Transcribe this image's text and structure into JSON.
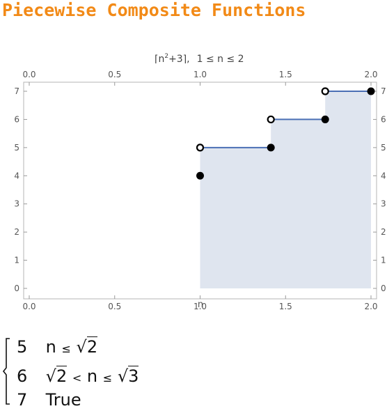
{
  "title": "Piecewise Composite Functions",
  "chart_data": {
    "type": "line",
    "title": "⌈n²+3⌉,   1 ≤ n ≤ 2",
    "title_expr_open": "⌈n",
    "title_expr_sup": "2",
    "title_expr_close": "+3⌉,",
    "title_domain": "1 ≤ n ≤ 2",
    "xlabel": "n",
    "ylabel": "",
    "xlim": [
      0,
      2
    ],
    "ylim": [
      0,
      7
    ],
    "x_ticks": [
      "0.0",
      "0.5",
      "1.0",
      "1.5",
      "2.0"
    ],
    "y_ticks": [
      "0",
      "1",
      "2",
      "3",
      "4",
      "5",
      "6",
      "7"
    ],
    "segments": [
      {
        "x": [
          1.0,
          1.41421
        ],
        "y": 5
      },
      {
        "x": [
          1.41421,
          1.73205
        ],
        "y": 6
      },
      {
        "x": [
          1.73205,
          2.0
        ],
        "y": 7
      }
    ],
    "filled_points": [
      {
        "x": 1.0,
        "y": 4
      },
      {
        "x": 1.41421,
        "y": 5
      },
      {
        "x": 1.73205,
        "y": 6
      },
      {
        "x": 2.0,
        "y": 7
      }
    ],
    "open_points": [
      {
        "x": 1.0,
        "y": 5
      },
      {
        "x": 1.41421,
        "y": 6
      },
      {
        "x": 1.73205,
        "y": 7
      }
    ],
    "line_color": "#4a6fb5",
    "fill_color": "#dfe5ef",
    "frame_color": "#b4b4b4"
  },
  "piecewise": {
    "rows": [
      {
        "value": "5",
        "n": "n",
        "le": "≤",
        "sqrt": "√",
        "rad": "2"
      },
      {
        "value": "6",
        "sqrt1": "√",
        "rad1": "2",
        "lt": "<",
        "n": "n",
        "le": "≤",
        "sqrt2": "√",
        "rad2": "3"
      },
      {
        "value": "7",
        "cond": "True"
      }
    ]
  }
}
